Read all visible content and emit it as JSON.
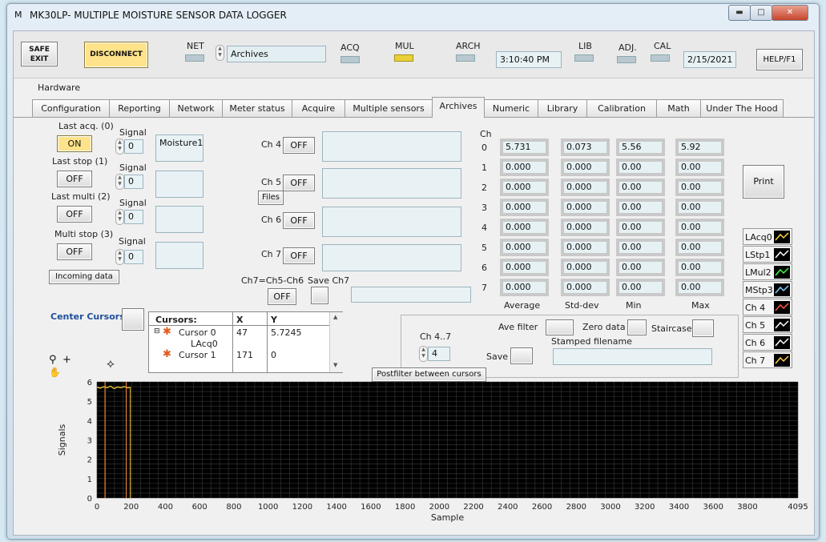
{
  "window": {
    "icon": "M",
    "title": "MK30LP- MULTIPLE MOISTURE SENSOR DATA LOGGER",
    "controls": [
      "minimize",
      "maximize",
      "close"
    ]
  },
  "top": {
    "safe_exit": "SAFE EXIT",
    "disconnect": "DISCONNECT",
    "net": "NET",
    "mode_value": "Archives",
    "acq": "ACQ",
    "mul": "MUL",
    "arch": "ARCH",
    "time": "3:10:40 PM",
    "lib": "LIB",
    "adj": "ADJ.",
    "cal": "CAL",
    "date": "2/15/2021",
    "help": "HELP/F1"
  },
  "hardware_tab": "Hardware",
  "tabs": [
    "Configuration",
    "Reporting",
    "Network",
    "Meter status",
    "Acquire",
    "Multiple sensors",
    "Archives",
    "Numeric",
    "Library",
    "Calibration",
    "Math",
    "Under The Hood"
  ],
  "active_tab": "Archives",
  "left": {
    "last_acq": "Last acq. (0)",
    "last_acq_state": "ON",
    "last_stop": "Last stop (1)",
    "last_stop_state": "OFF",
    "last_multi": "Last multi (2)",
    "last_multi_state": "OFF",
    "multi_stop": "Multi stop (3)",
    "multi_stop_state": "OFF",
    "signal": "Signal",
    "signal_values": [
      "0",
      "0",
      "0",
      "0"
    ],
    "names": [
      "Moisture1",
      "",
      "",
      ""
    ],
    "incoming": "Incoming data"
  },
  "mid": {
    "ch4": "Ch 4",
    "ch5": "Ch 5",
    "ch6": "Ch 6",
    "ch7": "Ch 7",
    "off": "OFF",
    "files": "Files",
    "ch7_formula": "Ch7=Ch5-Ch6",
    "save_ch7": "Save Ch7"
  },
  "stats": {
    "ch_header": "Ch",
    "channels": [
      "0",
      "1",
      "2",
      "3",
      "4",
      "5",
      "6",
      "7"
    ],
    "average": [
      "5.731",
      "0.000",
      "0.000",
      "0.000",
      "0.000",
      "0.000",
      "0.000",
      "0.000"
    ],
    "stddev": [
      "0.073",
      "0.000",
      "0.000",
      "0.000",
      "0.000",
      "0.000",
      "0.000",
      "0.000"
    ],
    "min": [
      "5.56",
      "0.00",
      "0.00",
      "0.00",
      "0.00",
      "0.00",
      "0.00",
      "0.00"
    ],
    "max": [
      "5.92",
      "0.00",
      "0.00",
      "0.00",
      "0.00",
      "0.00",
      "0.00",
      "0.00"
    ],
    "headers": [
      "Average",
      "Std-dev",
      "Min",
      "Max"
    ]
  },
  "print": "Print",
  "legend": [
    {
      "name": "LAcq0",
      "color": "#ffd23c"
    },
    {
      "name": "LStp1",
      "color": "#ffffff"
    },
    {
      "name": "LMul2",
      "color": "#3cff3c"
    },
    {
      "name": "MStp3",
      "color": "#7fd2ff"
    },
    {
      "name": "Ch 4",
      "color": "#ff5a3c"
    },
    {
      "name": "Ch 5",
      "color": "#ffffff"
    },
    {
      "name": "Ch 6",
      "color": "#ffffff"
    },
    {
      "name": "Ch 7",
      "color": "#ffd23c"
    }
  ],
  "cursors": {
    "center": "Center Cursors",
    "header": [
      "Cursors:",
      "X",
      "Y"
    ],
    "rows": [
      {
        "name": "Cursor 0",
        "sub": "LAcq0",
        "x": "47",
        "y": "5.7245"
      },
      {
        "name": "Cursor 1",
        "x": "171",
        "y": "0"
      }
    ]
  },
  "postfilter": {
    "ch47": "Ch 4..7",
    "ch_value": "4",
    "ave_filter": "Ave filter",
    "zero_data": "Zero data",
    "staircase": "Staircase",
    "stamped": "Stamped filename",
    "save": "Save",
    "title": "Postfilter between cursors"
  },
  "chart_data": {
    "type": "line",
    "xlabel": "Sample",
    "ylabel": "Signals",
    "xlim": [
      0,
      4095
    ],
    "ylim": [
      0,
      6
    ],
    "x_ticks": [
      0,
      200,
      400,
      600,
      800,
      1000,
      1200,
      1400,
      1600,
      1800,
      2000,
      2200,
      2400,
      2600,
      2800,
      3000,
      3200,
      3400,
      3600,
      3800,
      4095
    ],
    "y_ticks": [
      0,
      1,
      2,
      3,
      4,
      5,
      6
    ],
    "series": [
      {
        "name": "LAcq0",
        "color": "#ffd23c",
        "x": [
          0,
          20,
          40,
          60,
          80,
          100,
          120,
          140,
          160,
          180,
          195
        ],
        "y": [
          5.72,
          5.68,
          5.75,
          5.7,
          5.78,
          5.65,
          5.74,
          5.7,
          5.76,
          5.69,
          5.73
        ]
      }
    ],
    "cursors": [
      {
        "name": "Cursor 0",
        "x": 47,
        "color": "#ff8c3c"
      },
      {
        "name": "Cursor 1",
        "x": 171,
        "color": "#ff8c3c"
      }
    ],
    "grid": true
  }
}
